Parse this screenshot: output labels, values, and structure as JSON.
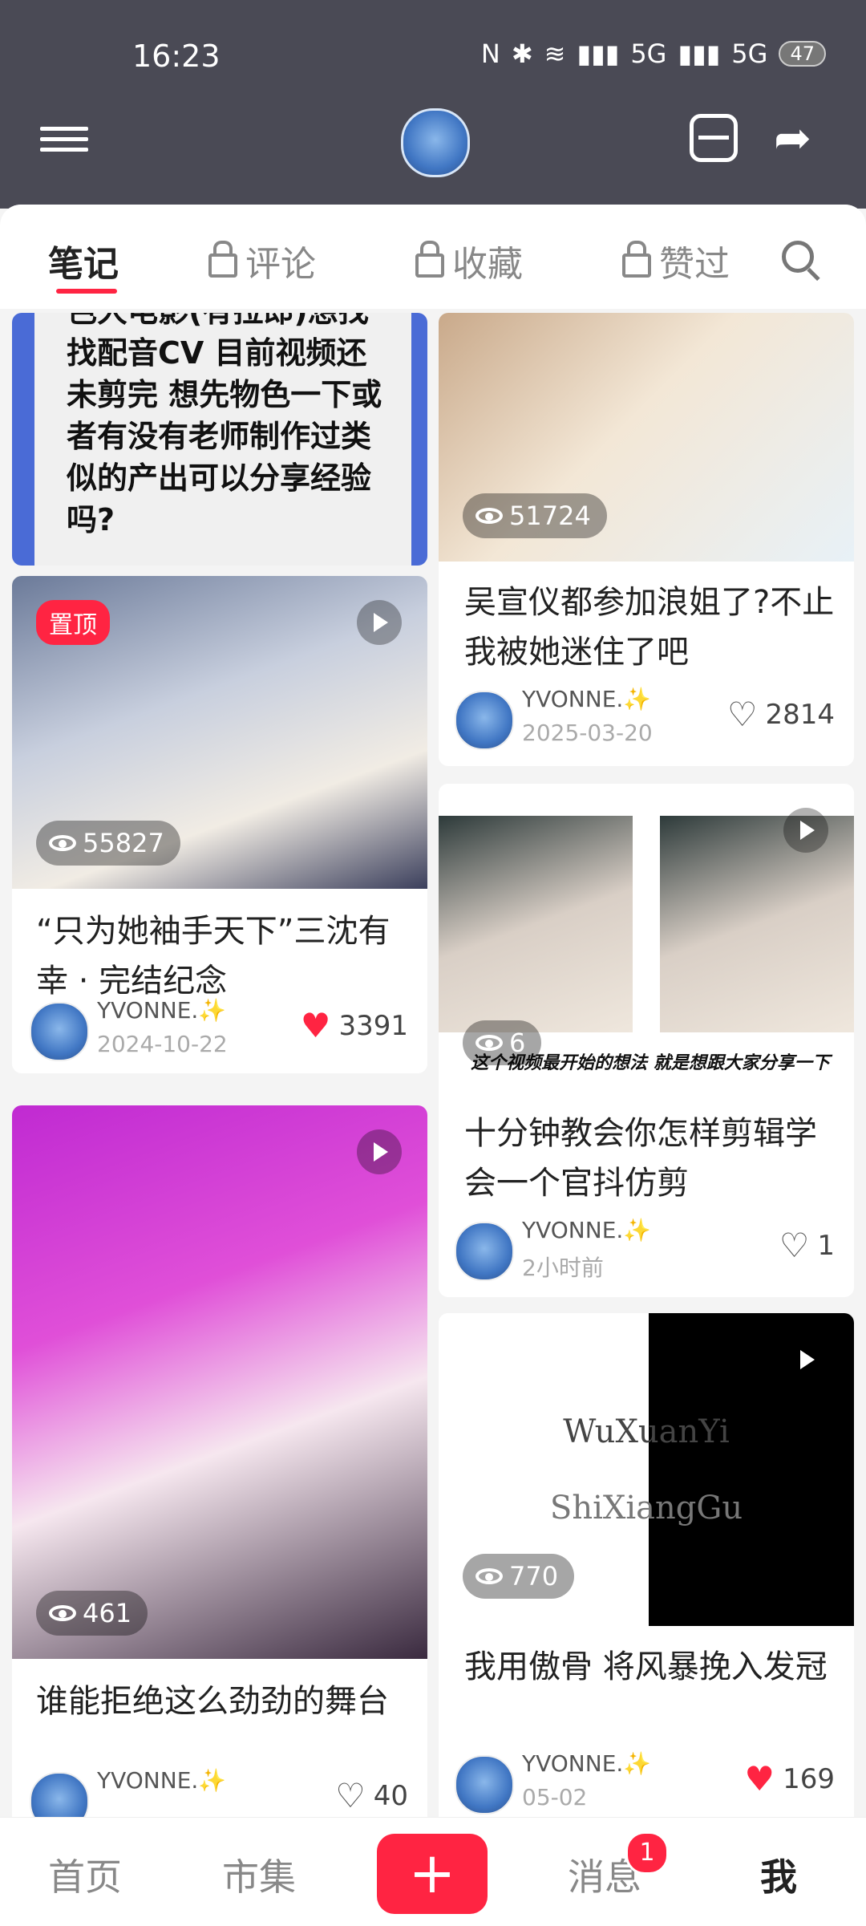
{
  "status_bar": {
    "time": "16:23",
    "network_a": "5G",
    "network_b": "5G",
    "battery": "47"
  },
  "tabs": [
    {
      "label": "笔记"
    },
    {
      "label": "评论"
    },
    {
      "label": "收藏"
    },
    {
      "label": "赞过"
    }
  ],
  "notes": [
    {
      "text": "色大电影(有拉郎)想找找配音CV 目前视频还未剪完 想先物色一下或者有没有老师制作过类似的产出可以分享经验吗?"
    },
    {
      "views": "51724",
      "title": "吴宣仪都参加浪姐了?不止我被她迷住了吧",
      "author": "YVONNE.✨",
      "date": "2025-03-20",
      "likes": "2814"
    },
    {
      "pinned": "置顶",
      "views": "55827",
      "title": "“只为她袖手天下”三沈有幸 · 完结纪念",
      "author": "YVONNE.✨",
      "date": "2024-10-22",
      "likes": "3391"
    },
    {
      "views": "6",
      "caption": "这个视频最开始的想法 就是想跟大家分享一下",
      "title": "十分钟教会你怎样剪辑学会一个官抖仿剪",
      "author": "YVONNE.✨",
      "date": "2小时前",
      "likes": "1"
    },
    {
      "views": "461",
      "title": "谁能拒绝这么劲劲的舞台",
      "author": "YVONNE.✨",
      "likes": "40"
    },
    {
      "views": "770",
      "overlay_text_1": "WuXuanYi",
      "overlay_text_2": "ShiXiangGu",
      "title": "我用傲骨 将风暴挽入发冠",
      "author": "YVONNE.✨",
      "date": "05-02",
      "likes": "169"
    }
  ],
  "bottom_nav": {
    "home": "首页",
    "market": "市集",
    "plus": "+",
    "messages": "消息",
    "messages_badge": "1",
    "me": "我"
  },
  "colors": {
    "accent": "#ff2442",
    "header": "#4a4a55"
  }
}
